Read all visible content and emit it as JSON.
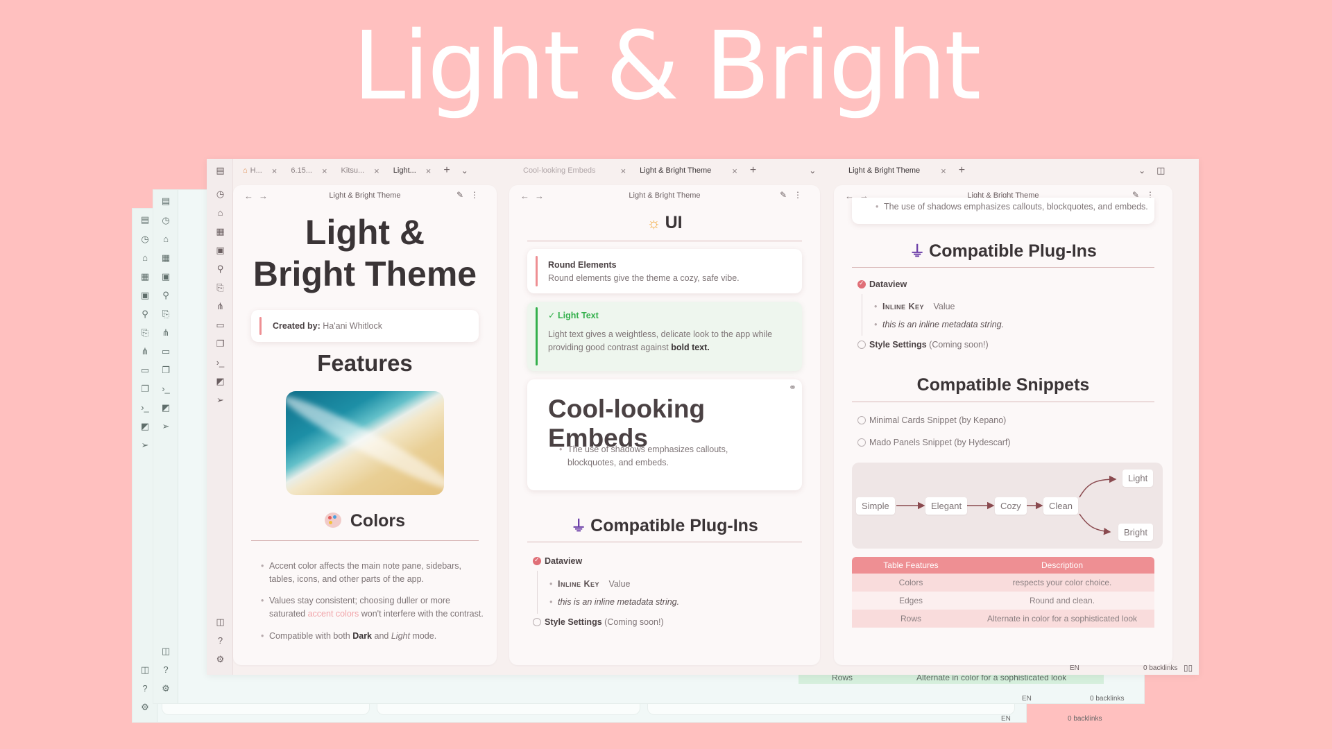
{
  "hero": {
    "title": "Light & Bright"
  },
  "colors": {
    "accent": "#ee8f93",
    "green": "#34b04c",
    "bg": "#ffc0bf"
  },
  "ghost_windows": {
    "back_row": {
      "label": "Rows",
      "value": "Alternate in color for a sophisticated look"
    },
    "status_mid": {
      "lang": "EN",
      "backlinks": "0 backlinks"
    },
    "status_back": {
      "lang": "EN",
      "backlinks": "0 backlinks"
    }
  },
  "tabs_left": [
    {
      "label": "H...",
      "icon": "home-icon"
    },
    {
      "label": "6.15..."
    },
    {
      "label": "Kitsu..."
    },
    {
      "label": "Light..."
    }
  ],
  "tabs_mid": [
    {
      "label": "Cool-looking Embeds"
    },
    {
      "label": "Light & Bright Theme"
    }
  ],
  "tabs_right": [
    {
      "label": "Light & Bright Theme"
    }
  ],
  "pane1": {
    "header": "Light & Bright Theme",
    "title": "Light & Bright Theme",
    "title_line1": "Light &",
    "title_line2": "Bright Theme",
    "created_label": "Created by:",
    "created_value": "Ha'ani Whitlock",
    "features_heading": "Features",
    "colors_heading": "Colors",
    "bullet1": "Accent color affects the main note pane, sidebars, tables, icons, and other parts of the app.",
    "bullet2_a": "Values stay consistent; choosing duller or more saturated",
    "bullet2_link": "accent colors",
    "bullet2_b": "won't interfere with the contrast.",
    "bullet3_a": "Compatible with both",
    "bullet3_dark": "Dark",
    "bullet3_and": "and",
    "bullet3_light": "Light",
    "bullet3_b": "mode."
  },
  "pane2": {
    "header": "Light & Bright Theme",
    "ui_heading": "UI",
    "round_title": "Round Elements",
    "round_text": "Round elements give the theme a cozy, safe vibe.",
    "light_title": "Light Text",
    "light_text_a": "Light text gives a weightless, delicate look to the app while providing good contrast against",
    "light_text_bold": "bold text.",
    "embed_title": "Cool-looking Embeds",
    "embed_text": "The use of shadows emphasizes callouts, blockquotes, and embeds.",
    "plugins_heading": "Compatible Plug-Ins",
    "dataview": "Dataview",
    "inline_key": "Inline Key",
    "inline_value": "Value",
    "inline_string": "this is an inline metadata string.",
    "style_settings": "Style Settings",
    "coming_soon": "(Coming soon!)"
  },
  "pane3": {
    "header": "Light & Bright Theme",
    "top_text": "The use of shadows emphasizes callouts, blockquotes, and embeds.",
    "plugins_heading": "Compatible Plug-Ins",
    "dataview": "Dataview",
    "inline_key": "Inline Key",
    "inline_value": "Value",
    "inline_string": "this is an inline metadata string.",
    "style_settings": "Style Settings",
    "coming_soon": "(Coming soon!)",
    "snippets_heading": "Compatible Snippets",
    "snippet1": "Minimal Cards Snippet (by Kepano)",
    "snippet2": "Mado Panels Snippet (by Hydescarf)",
    "flow": [
      "Simple",
      "Elegant",
      "Cozy",
      "Clean",
      "Light",
      "Bright"
    ],
    "table": {
      "headers": [
        "Table Features",
        "Description"
      ],
      "rows": [
        [
          "Colors",
          "respects your color choice."
        ],
        [
          "Edges",
          "Round and clean."
        ],
        [
          "Rows",
          "Alternate in color for a sophisticated look"
        ]
      ]
    },
    "status_lang": "EN",
    "status_backlinks": "0 backlinks"
  }
}
